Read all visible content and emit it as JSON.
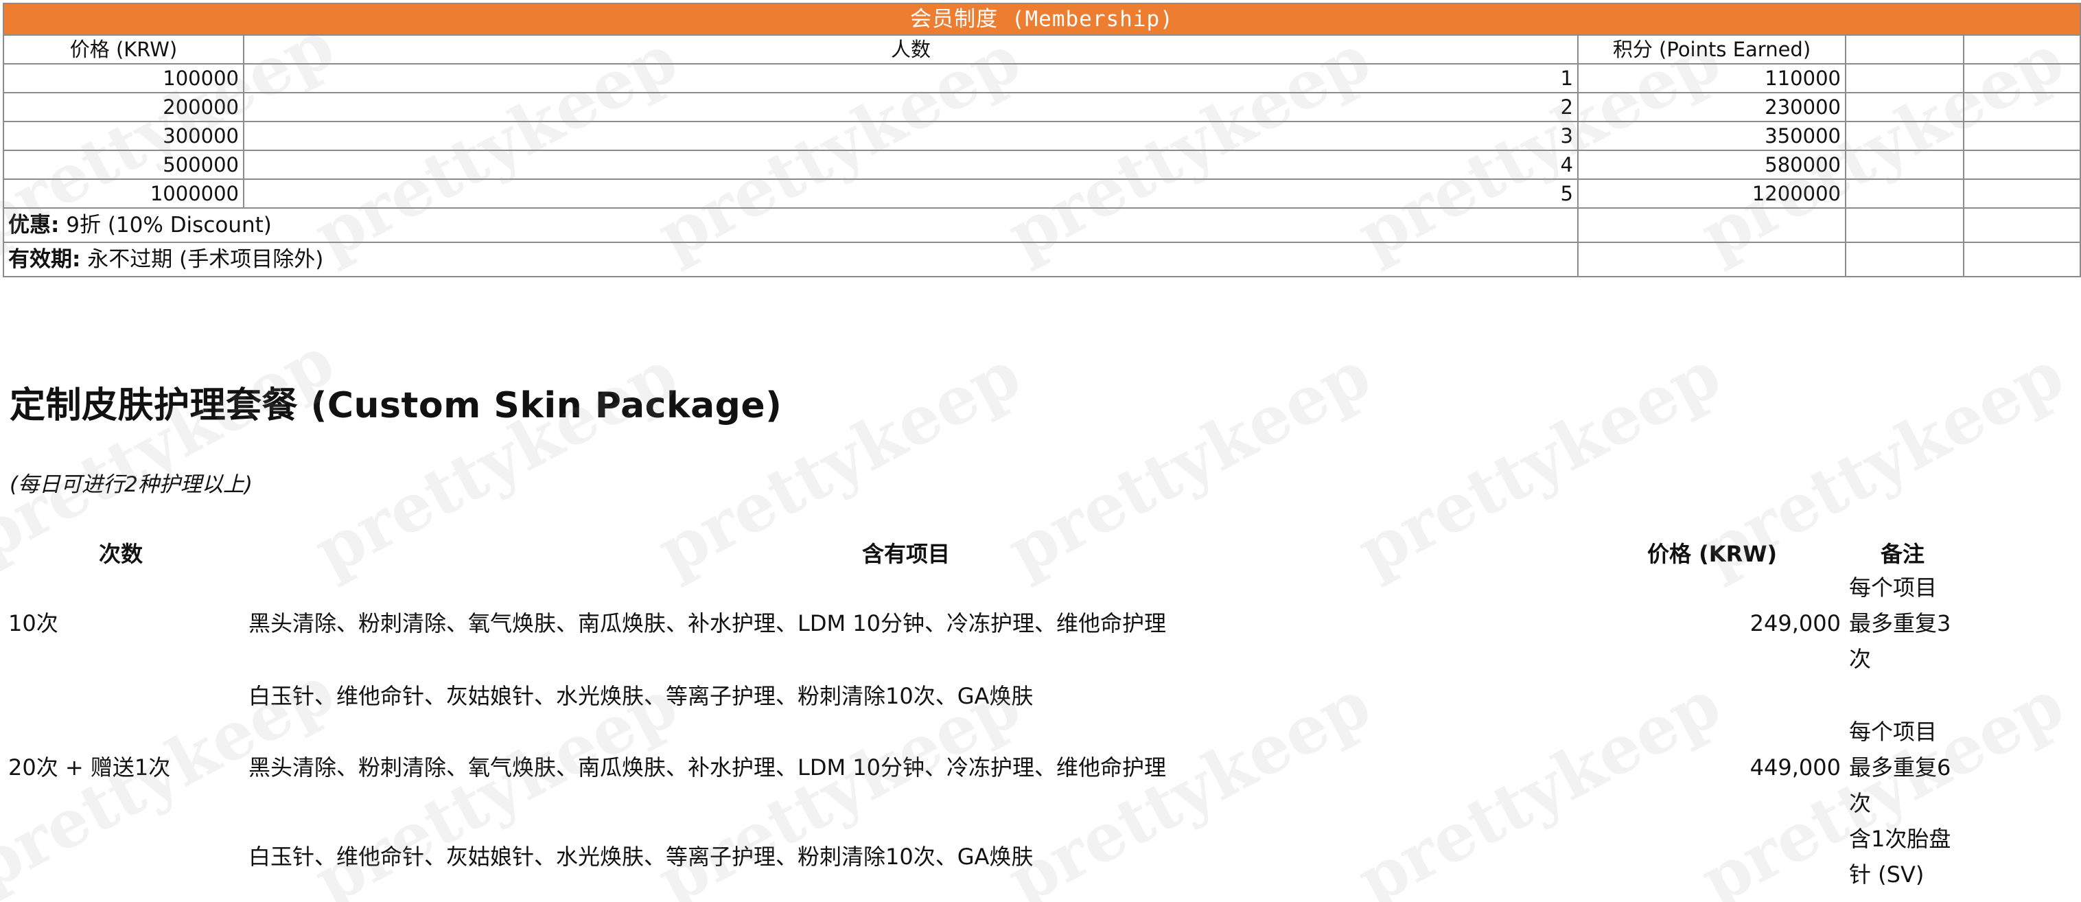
{
  "membership": {
    "banner": "会员制度 (Membership)",
    "headers": [
      "价格 (KRW)",
      "人数",
      "积分 (Points Earned)"
    ],
    "rows": [
      {
        "price": "100000",
        "count": "1",
        "points": "110000"
      },
      {
        "price": "200000",
        "count": "2",
        "points": "230000"
      },
      {
        "price": "300000",
        "count": "3",
        "points": "350000"
      },
      {
        "price": "500000",
        "count": "4",
        "points": "580000"
      },
      {
        "price": "1000000",
        "count": "5",
        "points": "1200000"
      }
    ],
    "discount_label": "优惠:",
    "discount_value": " 9折 (10% Discount)",
    "validity_label": "有效期:",
    "validity_value": " 永不过期 (手术项目除外)"
  },
  "package": {
    "title": "定制皮肤护理套餐 (Custom Skin Package)",
    "subtitle": "(每日可进行2种护理以上)",
    "headers": {
      "times": "次数",
      "items": "含有项目",
      "price": "价格 (KRW)",
      "remark": "备注"
    },
    "rows": [
      {
        "times": "10次",
        "items_1": "黑头清除、粉刺清除、氧气焕肤、南瓜焕肤、补水护理、LDM 10分钟、冷冻护理、维他命护理",
        "items_2": "白玉针、维他命针、灰姑娘针、水光焕肤、等离子护理、粉刺清除10次、GA焕肤",
        "price": "249,000",
        "remark_1": "每个项目",
        "remark_2": "最多重复3",
        "remark_3": "次"
      },
      {
        "times": "20次 + 赠送1次",
        "items_1": "黑头清除、粉刺清除、氧气焕肤、南瓜焕肤、补水护理、LDM 10分钟、冷冻护理、维他命护理",
        "items_2": "白玉针、维他命针、灰姑娘针、水光焕肤、等离子护理、粉刺清除10次、GA焕肤",
        "price": "449,000",
        "remark_1": "每个项目",
        "remark_2": "最多重复6",
        "remark_3": "次",
        "remark_4": "含1次胎盘",
        "remark_5": "针 (SV)"
      }
    ]
  },
  "watermark_text": "prettykeep",
  "colors": {
    "banner_bg": "#ed7d31",
    "banner_text": "#ffffff",
    "grid": "#8c8c8c"
  }
}
